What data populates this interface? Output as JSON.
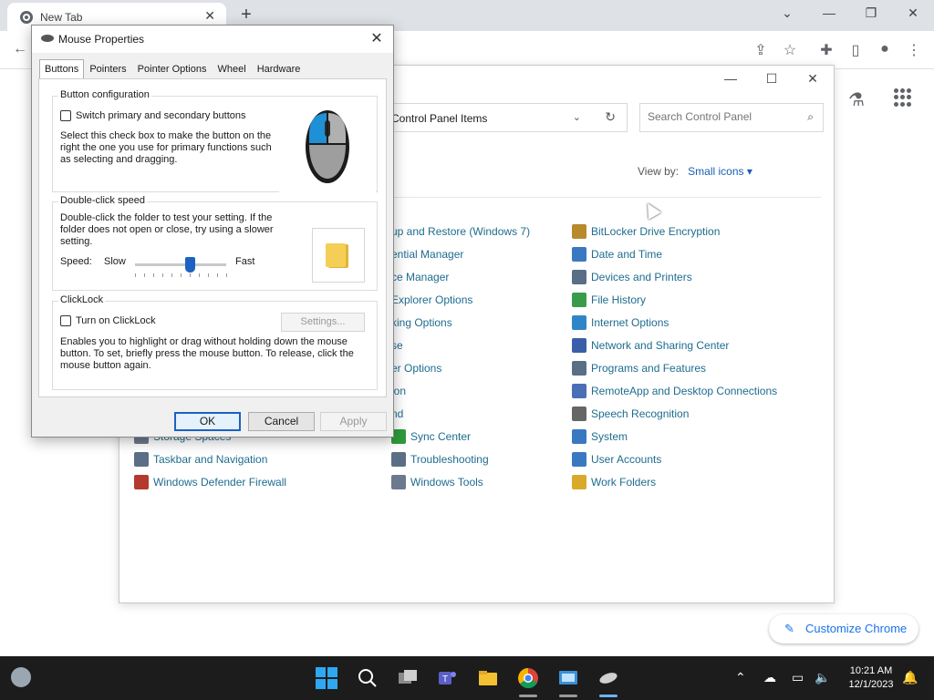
{
  "browser": {
    "tab_title": "New Tab",
    "customize_label": "Customize Chrome"
  },
  "control_panel": {
    "address": "Control Panel Items",
    "search_placeholder": "Search Control Panel",
    "view_by_label": "View by:",
    "view_by_value": "Small icons",
    "col1": [
      {
        "label": "Storage Spaces",
        "icon": "storage-icon",
        "color": "#6b7a8f"
      },
      {
        "label": "Taskbar and Navigation",
        "icon": "taskbar-icon",
        "color": "#5a6e86"
      },
      {
        "label": "Windows Defender Firewall",
        "icon": "firewall-icon",
        "color": "#b33a2c"
      }
    ],
    "col2": [
      {
        "label": "up and Restore (Windows 7)",
        "icon": "",
        "color": ""
      },
      {
        "label": "ential Manager",
        "icon": "",
        "color": ""
      },
      {
        "label": "ce Manager",
        "icon": "",
        "color": ""
      },
      {
        "label": "Explorer Options",
        "icon": "",
        "color": ""
      },
      {
        "label": "king Options",
        "icon": "",
        "color": ""
      },
      {
        "label": "se",
        "icon": "",
        "color": ""
      },
      {
        "label": "er Options",
        "icon": "",
        "color": ""
      },
      {
        "label": "ion",
        "icon": "",
        "color": ""
      },
      {
        "label": "nd",
        "icon": "",
        "color": ""
      },
      {
        "label": "Sync Center",
        "icon": "sync-icon",
        "color": "#2e9b3a"
      },
      {
        "label": "Troubleshooting",
        "icon": "troubleshooting-icon",
        "color": "#5a6e86"
      },
      {
        "label": "Windows Tools",
        "icon": "tools-icon",
        "color": "#6b7a8f"
      }
    ],
    "col3": [
      {
        "label": "BitLocker Drive Encryption",
        "icon": "bitlocker-icon",
        "color": "#b88a2c"
      },
      {
        "label": "Date and Time",
        "icon": "date-time-icon",
        "color": "#3b78c2"
      },
      {
        "label": "Devices and Printers",
        "icon": "devices-printers-icon",
        "color": "#5a6e86"
      },
      {
        "label": "File History",
        "icon": "file-history-icon",
        "color": "#3a9b4b"
      },
      {
        "label": "Internet Options",
        "icon": "internet-options-icon",
        "color": "#2e86c8"
      },
      {
        "label": "Network and Sharing Center",
        "icon": "network-icon",
        "color": "#3b5ea8"
      },
      {
        "label": "Programs and Features",
        "icon": "programs-icon",
        "color": "#5a6e86"
      },
      {
        "label": "RemoteApp and Desktop Connections",
        "icon": "remoteapp-icon",
        "color": "#4a6fb5"
      },
      {
        "label": "Speech Recognition",
        "icon": "speech-icon",
        "color": "#666666"
      },
      {
        "label": "System",
        "icon": "system-icon",
        "color": "#3b78c2"
      },
      {
        "label": "User Accounts",
        "icon": "user-accounts-icon",
        "color": "#3b78c2"
      },
      {
        "label": "Work Folders",
        "icon": "work-folders-icon",
        "color": "#d9a92b"
      }
    ]
  },
  "mouse_props": {
    "title": "Mouse Properties",
    "tabs": [
      "Buttons",
      "Pointers",
      "Pointer Options",
      "Wheel",
      "Hardware"
    ],
    "active_tab": "Buttons",
    "button_config": {
      "group_label": "Button configuration",
      "switch_label": "Switch primary and secondary buttons",
      "switch_checked": false,
      "description": "Select this check box to make the button on the right the one you use for primary functions such as selecting and dragging."
    },
    "double_click": {
      "group_label": "Double-click speed",
      "description": "Double-click the folder to test your setting. If the folder does not open or close, try using a slower setting.",
      "speed_label": "Speed:",
      "slow_label": "Slow",
      "fast_label": "Fast",
      "speed_fraction": 0.6
    },
    "clicklock": {
      "group_label": "ClickLock",
      "toggle_label": "Turn on ClickLock",
      "toggle_checked": false,
      "settings_label": "Settings...",
      "description": "Enables you to highlight or drag without holding down the mouse button. To set, briefly press the mouse button. To release, click the mouse button again."
    },
    "ok_label": "OK",
    "cancel_label": "Cancel",
    "apply_label": "Apply"
  },
  "taskbar": {
    "time": "10:21 AM",
    "date": "12/1/2023"
  },
  "colors": {
    "accent": "#1b62c1",
    "link": "#1e6c8e",
    "taskbar": "#1c1c1c"
  }
}
